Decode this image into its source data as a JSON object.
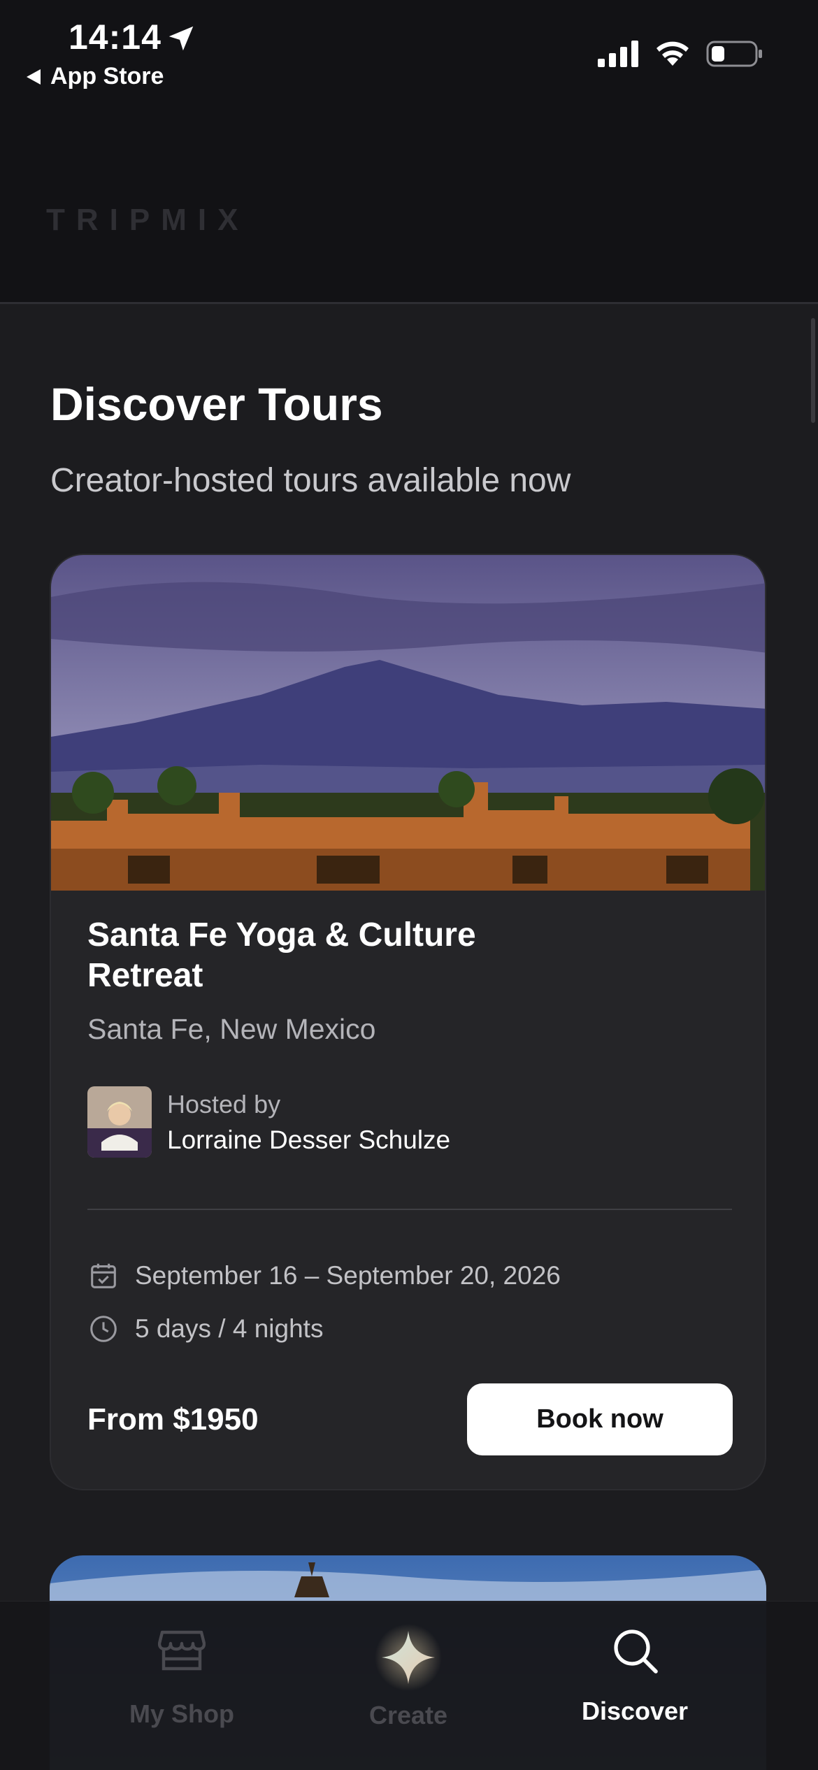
{
  "status_bar": {
    "time": "14:14",
    "back_app": "App Store"
  },
  "header": {
    "brand": "TRIPMIX"
  },
  "page": {
    "title": "Discover Tours",
    "subtitle": "Creator-hosted tours available now"
  },
  "tour": {
    "title": "Santa Fe Yoga & Culture Retreat",
    "location": "Santa Fe, New Mexico",
    "hosted_by_label": "Hosted by",
    "host_name": "Lorraine Desser Schulze",
    "dates": "September 16 – September 20, 2026",
    "duration": "5 days / 4 nights",
    "price": "From $1950",
    "book_label": "Book now"
  },
  "tabs": [
    {
      "label": "My Shop",
      "icon": "shop-icon",
      "active": false
    },
    {
      "label": "Create",
      "icon": "sparkle-icon",
      "active": false
    },
    {
      "label": "Discover",
      "icon": "search-icon",
      "active": true
    }
  ],
  "colors": {
    "background": "#1c1c1f",
    "card": "#252528",
    "button": "#ffffff",
    "tab_active": "#ffffff",
    "tab_inactive": "#4a4a50"
  }
}
